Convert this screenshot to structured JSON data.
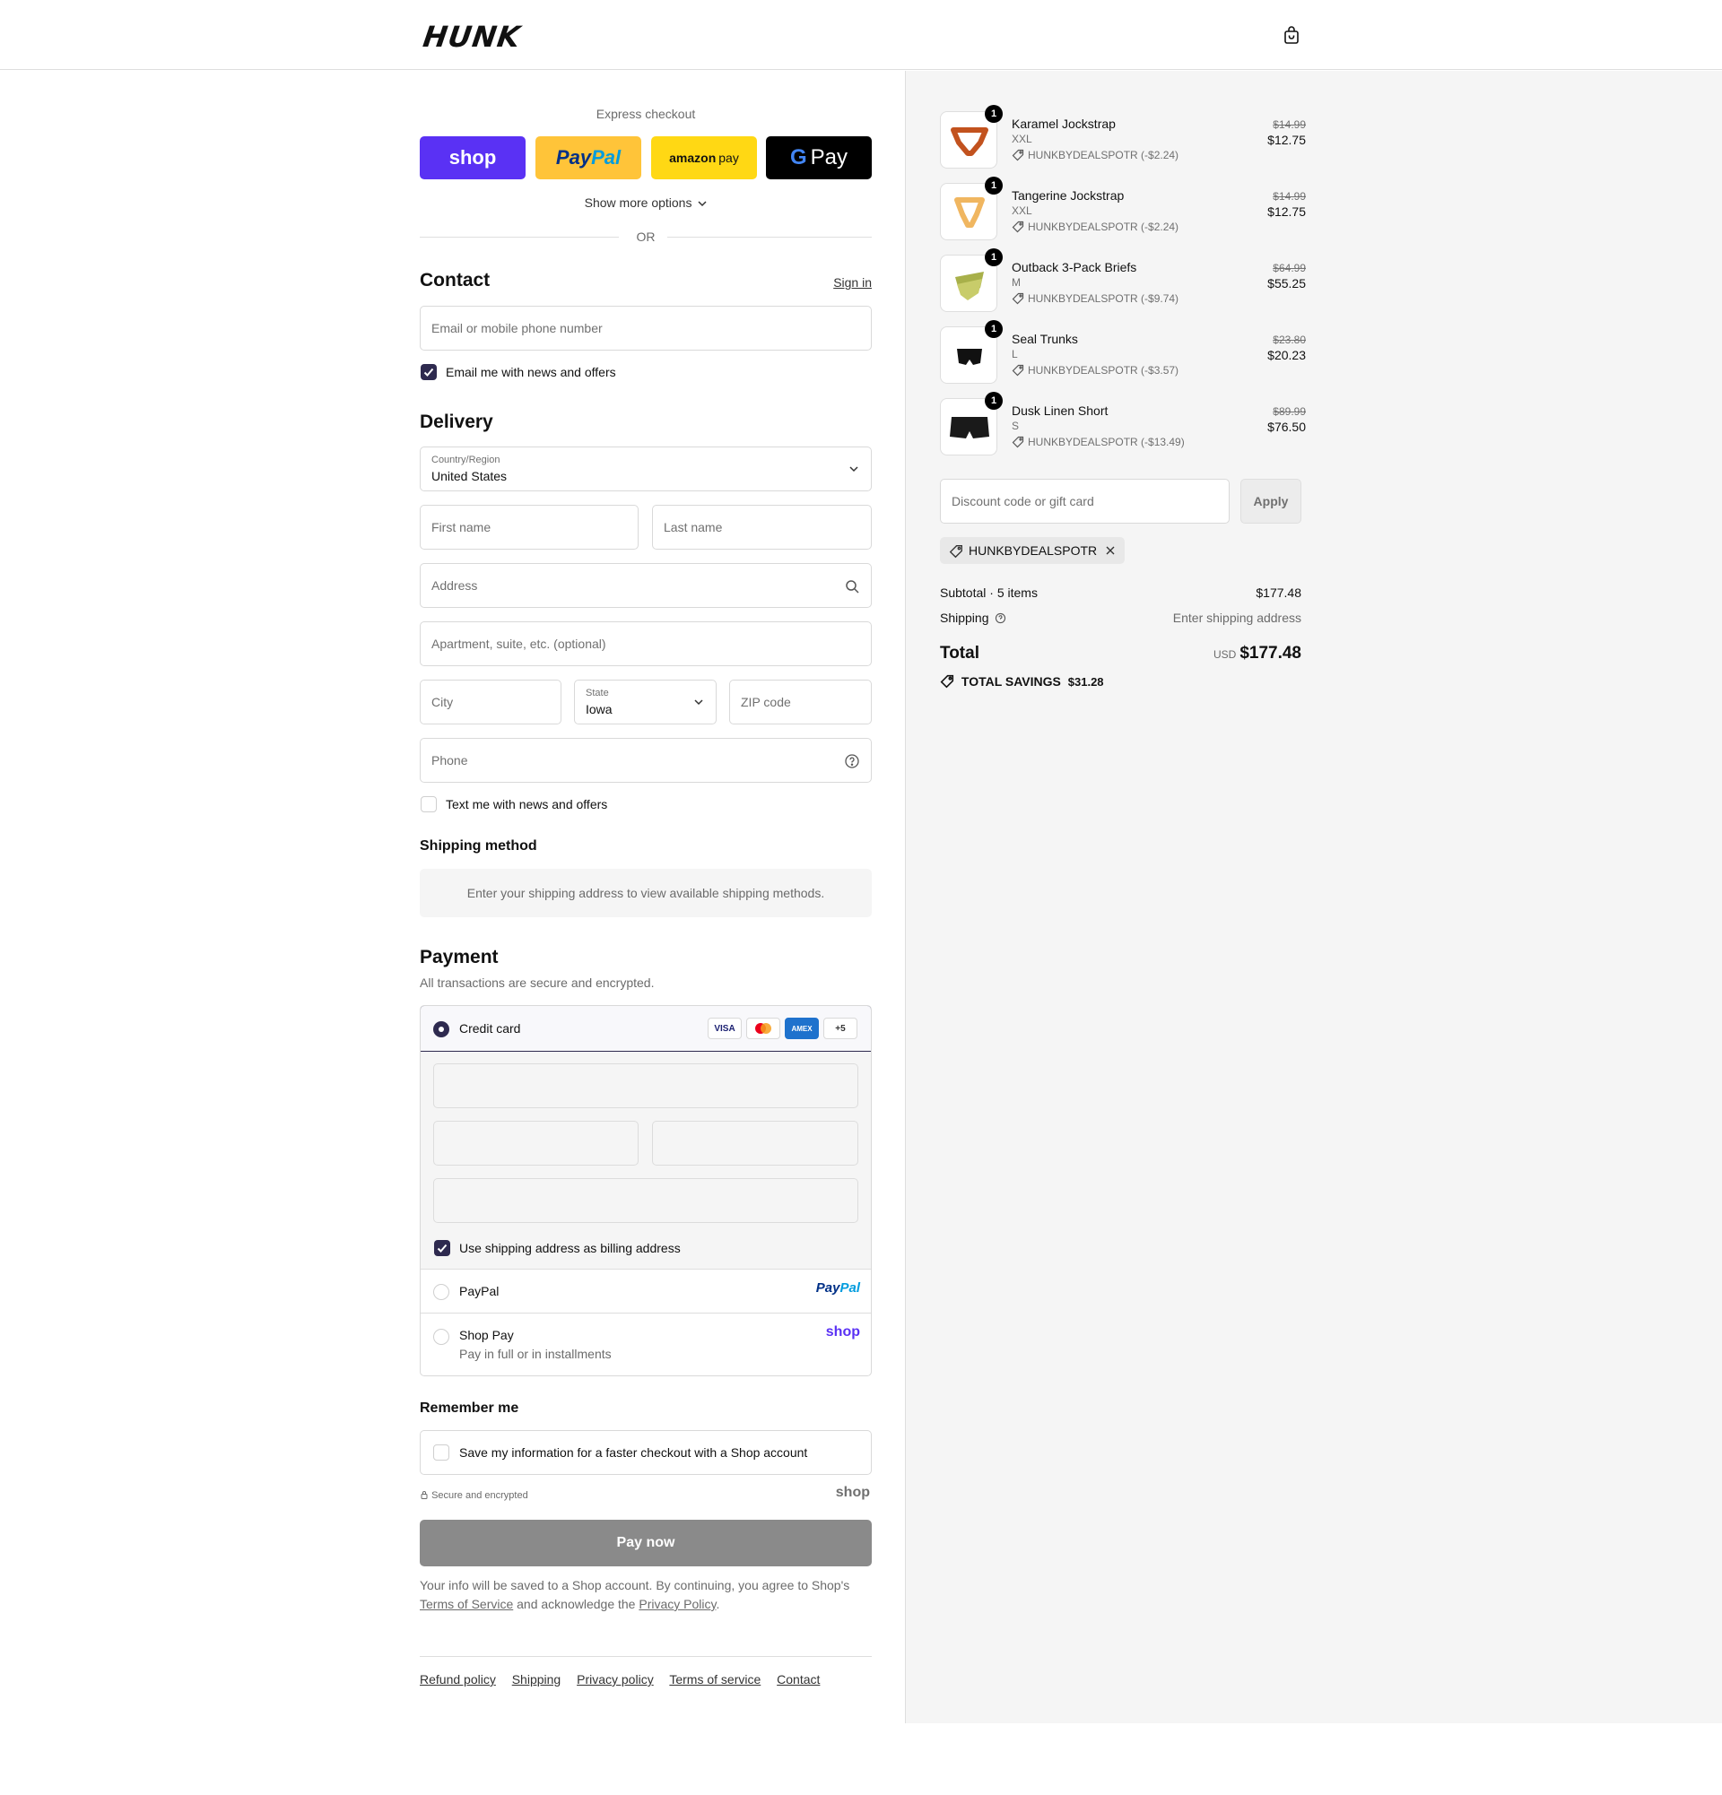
{
  "header": {
    "logo": "HUNK",
    "cart_icon": "shopping-bag-icon"
  },
  "express": {
    "title": "Express checkout",
    "shop_label": "shop",
    "paypal_pay": "Pay",
    "paypal_pal": "Pal",
    "amazon_label": "amazon",
    "amazon_pay": "pay",
    "gpay_g": "G",
    "gpay_label": "Pay",
    "show_more": "Show more options",
    "or": "OR"
  },
  "contact": {
    "title": "Contact",
    "sign_in": "Sign in",
    "email_placeholder": "Email or mobile phone number",
    "email_news_label": "Email me with news and offers",
    "email_news_checked": true
  },
  "delivery": {
    "title": "Delivery",
    "country_label": "Country/Region",
    "country_value": "United States",
    "first_name": "First name",
    "last_name": "Last name",
    "address": "Address",
    "apartment": "Apartment, suite, etc. (optional)",
    "city": "City",
    "state_label": "State",
    "state_value": "Iowa",
    "zip": "ZIP code",
    "phone": "Phone",
    "text_news_label": "Text me with news and offers",
    "text_news_checked": false
  },
  "shipping_method": {
    "title": "Shipping method",
    "message": "Enter your shipping address to view available shipping methods."
  },
  "payment": {
    "title": "Payment",
    "subtitle": "All transactions are secure and encrypted.",
    "credit_card_label": "Credit card",
    "cards": [
      "VISA",
      "MC",
      "AMEX",
      "+5"
    ],
    "billing_same_label": "Use shipping address as billing address",
    "paypal_label": "PayPal",
    "paypal_logo_pay": "Pay",
    "paypal_logo_pal": "Pal",
    "shoppay_label": "Shop Pay",
    "shoppay_sub": "Pay in full or in installments",
    "shoppay_logo": "shop"
  },
  "remember": {
    "title": "Remember me",
    "save_label": "Save my information for a faster checkout with a Shop account",
    "secure": "Secure and encrypted",
    "shop_logo": "shop"
  },
  "pay_now": "Pay now",
  "legal": {
    "text1": "Your info will be saved to a Shop account. By continuing, you agree to Shop's",
    "terms": "Terms of Service",
    "text2": " and acknowledge the ",
    "privacy": "Privacy Policy",
    "text3": "."
  },
  "footer": {
    "links": [
      "Refund policy",
      "Shipping",
      "Privacy policy",
      "Terms of service",
      "Contact"
    ]
  },
  "cart": {
    "items": [
      {
        "qty": "1",
        "name": "Karamel Jockstrap",
        "variant": "XXL",
        "discount": "HUNKBYDEALSPOTR (-$2.24)",
        "old_price": "$14.99",
        "price": "$12.75",
        "color": "#c2521e"
      },
      {
        "qty": "1",
        "name": "Tangerine Jockstrap",
        "variant": "XXL",
        "discount": "HUNKBYDEALSPOTR (-$2.24)",
        "old_price": "$14.99",
        "price": "$12.75",
        "color": "#f0b660"
      },
      {
        "qty": "1",
        "name": "Outback 3-Pack Briefs",
        "variant": "M",
        "discount": "HUNKBYDEALSPOTR (-$9.74)",
        "old_price": "$64.99",
        "price": "$55.25",
        "color": "#a8b04a"
      },
      {
        "qty": "1",
        "name": "Seal Trunks",
        "variant": "L",
        "discount": "HUNKBYDEALSPOTR (-$3.57)",
        "old_price": "$23.80",
        "price": "$20.23",
        "color": "#111111"
      },
      {
        "qty": "1",
        "name": "Dusk Linen Short",
        "variant": "S",
        "discount": "HUNKBYDEALSPOTR (-$13.49)",
        "old_price": "$89.99",
        "price": "$76.50",
        "color": "#1a1a1a"
      }
    ],
    "discount_placeholder": "Discount code or gift card",
    "apply": "Apply",
    "applied_code": "HUNKBYDEALSPOTR",
    "subtotal_label": "Subtotal · 5 items",
    "subtotal_value": "$177.48",
    "shipping_label": "Shipping",
    "shipping_value": "Enter shipping address",
    "total_label": "Total",
    "currency": "USD",
    "total_value": "$177.48",
    "savings_label": "TOTAL SAVINGS",
    "savings_value": "$31.28"
  }
}
